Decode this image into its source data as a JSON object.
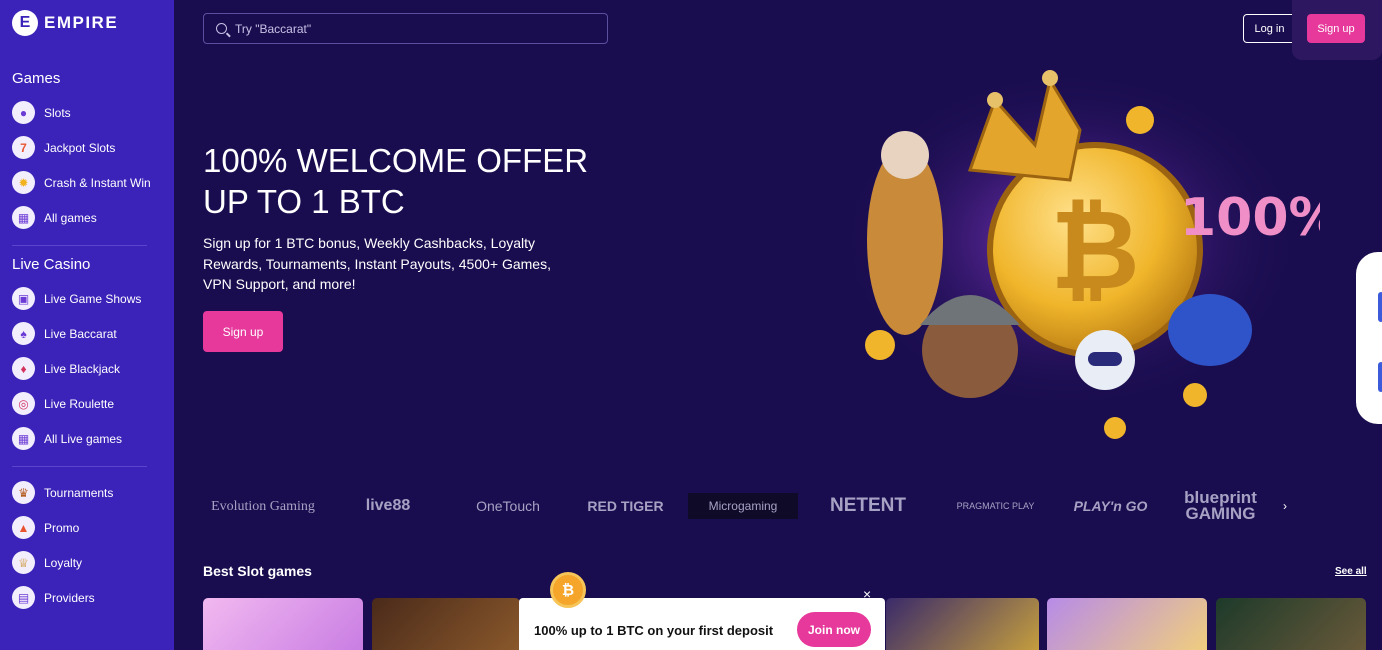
{
  "brand": {
    "logo_letter": "E",
    "name": "EMPIRE"
  },
  "sidebar": {
    "games_title": "Games",
    "games": [
      {
        "label": "Slots",
        "icon": "cherry-icon"
      },
      {
        "label": "Jackpot Slots",
        "icon": "seven-icon"
      },
      {
        "label": "Crash & Instant Win",
        "icon": "sun-icon"
      },
      {
        "label": "All games",
        "icon": "grid-icon"
      }
    ],
    "live_title": "Live Casino",
    "live": [
      {
        "label": "Live Game Shows",
        "icon": "tv-icon"
      },
      {
        "label": "Live Baccarat",
        "icon": "card-icon"
      },
      {
        "label": "Live Blackjack",
        "icon": "card-icon"
      },
      {
        "label": "Live Roulette",
        "icon": "roulette-icon"
      },
      {
        "label": "All Live games",
        "icon": "grid-icon"
      }
    ],
    "more": [
      {
        "label": "Tournaments",
        "icon": "trophy-icon"
      },
      {
        "label": "Promo",
        "icon": "fire-icon"
      },
      {
        "label": "Loyalty",
        "icon": "crown-icon"
      },
      {
        "label": "Providers",
        "icon": "gift-icon"
      }
    ]
  },
  "header": {
    "search_placeholder": "Try \"Baccarat\"",
    "login": "Log in",
    "signup": "Sign up"
  },
  "hero": {
    "title_line1": "100% WELCOME OFFER",
    "title_line2": "UP TO 1 BTC",
    "text": "Sign up for 1 BTC bonus, Weekly Cashbacks, Loyalty Rewards, Tournaments, Instant Payouts, 4500+ Games, VPN Support, and more!",
    "button": "Sign up",
    "art_badge": "100%"
  },
  "providers": [
    "Evolution Gaming",
    "live88",
    "OneTouch",
    "RED TIGER",
    "Microgaming",
    "NETENT",
    "PRAGMATIC PLAY",
    "PLAY'n GO",
    "blueprint GAMING"
  ],
  "best_slots": {
    "title": "Best Slot games",
    "see_all": "See all"
  },
  "promo": {
    "text": "100% up to 1 BTC on your first deposit",
    "button": "Join now",
    "close": "×",
    "coin": "₿"
  },
  "colors": {
    "sidebar": "#3b22b8",
    "background": "#1a0d4f",
    "accent": "#e6399b"
  }
}
